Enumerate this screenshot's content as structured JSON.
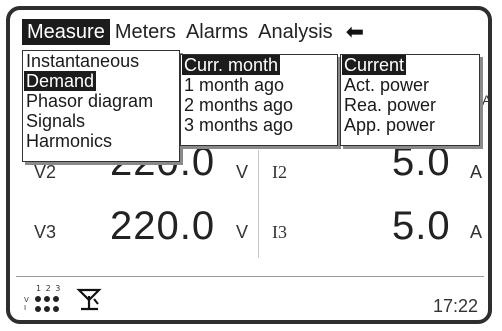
{
  "menubar": {
    "items": [
      {
        "label": "Measure",
        "active": true
      },
      {
        "label": "Meters",
        "active": false
      },
      {
        "label": "Alarms",
        "active": false
      },
      {
        "label": "Analysis",
        "active": false
      }
    ],
    "back_icon": "back-arrow-icon"
  },
  "measure_menu": {
    "items": [
      "Instantaneous",
      "Demand",
      "Phasor diagram",
      "Signals",
      "Harmonics"
    ],
    "selected": "Demand"
  },
  "period_menu": {
    "items": [
      "Curr. month",
      "1 month ago",
      "2 months ago",
      "3 months ago"
    ],
    "selected": "Curr. month"
  },
  "type_menu": {
    "items": [
      "Current",
      "Act. power",
      "Rea. power",
      "App. power"
    ],
    "selected": "Current"
  },
  "readings": {
    "v2": {
      "label": "V2",
      "value": "220.0",
      "unit": "V"
    },
    "i2": {
      "label": "I2",
      "value": "5.0",
      "unit": "A"
    },
    "v3": {
      "label": "V3",
      "value": "220.0",
      "unit": "V"
    },
    "i3": {
      "label": "I3",
      "value": "5.0",
      "unit": "A"
    },
    "partial_unit": "A"
  },
  "statusbar": {
    "phase_digits": "1 2 3",
    "phase_letters": "V I",
    "time": "17:22",
    "signal_icon": "signal-antenna-icon",
    "phase_icon": "phase-dots-icon"
  }
}
